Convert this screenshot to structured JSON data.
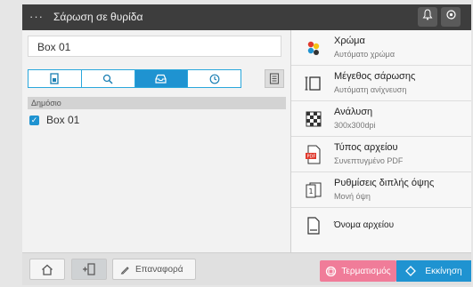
{
  "topbar": {
    "menu_glyph": "···",
    "title": "Σάρωση σε θυρίδα",
    "icons": [
      "bell-icon",
      "settings-icon"
    ]
  },
  "box_input": {
    "value": "Box 01"
  },
  "tabs": [
    {
      "icon": "document-box-icon",
      "active": false
    },
    {
      "icon": "search-icon",
      "active": false
    },
    {
      "icon": "inbox-icon",
      "active": true
    },
    {
      "icon": "clock-icon",
      "active": false
    }
  ],
  "list": {
    "header": "Δημόσιο",
    "items": [
      {
        "label": "Box 01",
        "checked": true
      }
    ]
  },
  "settings": [
    {
      "icon": "color-icon",
      "name": "Χρώμα",
      "value": "Αυτόματο χρώμα"
    },
    {
      "icon": "scan-size-icon",
      "name": "Μέγεθος σάρωσης",
      "value": "Αυτόματη ανίχνευση"
    },
    {
      "icon": "resolution-icon",
      "name": "Ανάλυση",
      "value": "300x300dpi"
    },
    {
      "icon": "pdf-file-icon",
      "name": "Τύπος αρχείου",
      "value": "Συνεπτυγμένο PDF"
    },
    {
      "icon": "duplex-icon",
      "name": "Ρυθμίσεις διπλής όψης",
      "value": "Μονή όψη"
    },
    {
      "icon": "file-name-icon",
      "name": "Όνομα αρχείου",
      "value": ""
    }
  ],
  "bottombar": {
    "home_icon": "home-icon",
    "device_icon": "device-icon",
    "edit_label": "Επαναφορά",
    "reset_label": "Τερματισμός",
    "start_label": "Εκκίνηση"
  },
  "colors": {
    "accent": "#1f93d1",
    "reset": "#f07c99",
    "topbar": "#3d3d3d"
  }
}
